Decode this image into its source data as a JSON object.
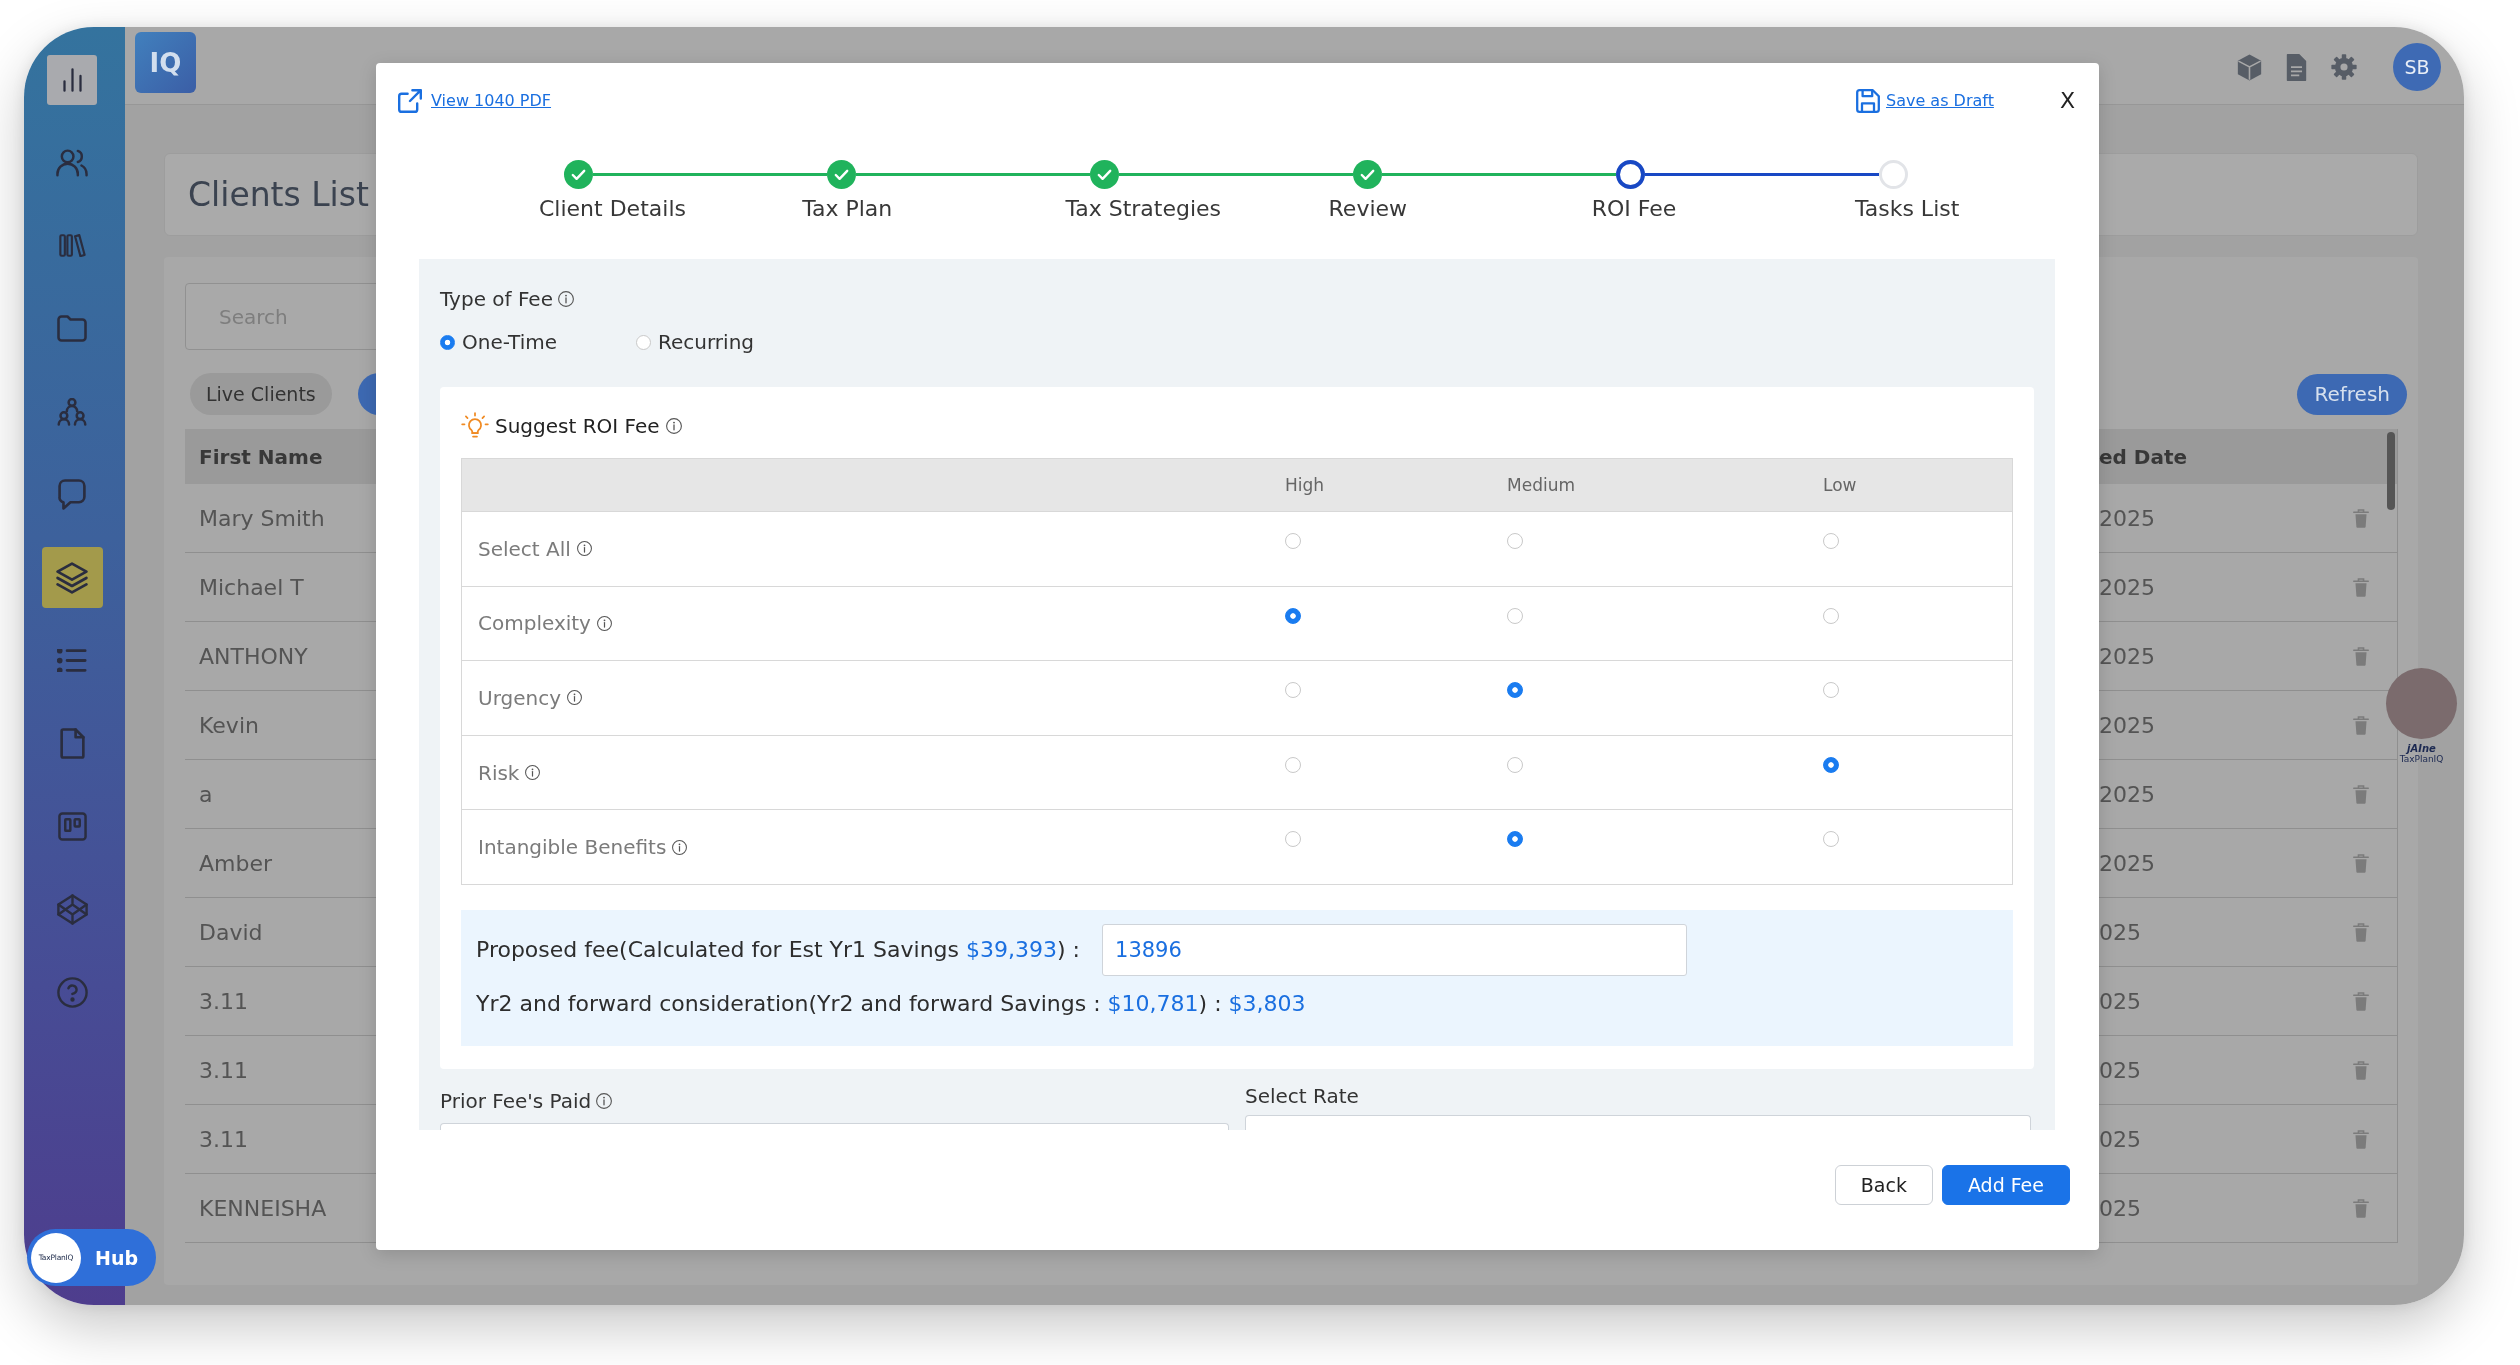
{
  "sidebar": {
    "items": [
      {
        "highlighted": true,
        "selected": false
      },
      {
        "highlighted": false,
        "selected": false
      },
      {
        "highlighted": false,
        "selected": false
      },
      {
        "highlighted": false,
        "selected": false
      },
      {
        "highlighted": false,
        "selected": false
      },
      {
        "highlighted": false,
        "selected": false
      },
      {
        "highlighted": false,
        "selected": true
      },
      {
        "highlighted": false,
        "selected": false
      },
      {
        "highlighted": false,
        "selected": false
      },
      {
        "highlighted": false,
        "selected": false
      },
      {
        "highlighted": false,
        "selected": false
      },
      {
        "highlighted": false,
        "selected": false
      }
    ]
  },
  "header": {
    "logo": "IQ",
    "avatar": "SB"
  },
  "clients_list": {
    "title": "Clients List",
    "search": {
      "placeholder": "Search"
    },
    "filters": [
      {
        "label": "Live Clients",
        "selected": false
      },
      {
        "selected": true
      }
    ],
    "refresh_button": "Refresh",
    "table": {
      "columns": [
        "First Name",
        "ed Date"
      ],
      "rows": [
        {
          "cells": [
            "Mary Smith",
            "2025"
          ]
        },
        {
          "cells": [
            "Michael T",
            "2025"
          ]
        },
        {
          "cells": [
            "ANTHONY",
            "2025"
          ]
        },
        {
          "cells": [
            "Kevin",
            "2025"
          ]
        },
        {
          "cells": [
            "a",
            "2025"
          ]
        },
        {
          "cells": [
            "Amber",
            "2025"
          ]
        },
        {
          "cells": [
            "David",
            "025"
          ]
        },
        {
          "cells": [
            "3.11",
            "025"
          ]
        },
        {
          "cells": [
            "3.11",
            "025"
          ]
        },
        {
          "cells": [
            "3.11",
            "025"
          ]
        },
        {
          "cells": [
            "KENNEISHA",
            "025"
          ]
        }
      ]
    }
  },
  "assistant": {
    "name": "jAIne",
    "brand": "TaxPlanIQ"
  },
  "hub": {
    "logo": "TaxPlanIQ",
    "label": "Hub"
  },
  "modal": {
    "view_pdf_link": "View 1040 PDF",
    "save_draft_link": "Save as Draft",
    "close": "X",
    "steps": [
      {
        "label": "Client Details",
        "completed": true,
        "selected": false
      },
      {
        "label": "Tax Plan",
        "completed": true,
        "selected": false
      },
      {
        "label": "Tax Strategies",
        "completed": true,
        "selected": false
      },
      {
        "label": "Review",
        "completed": true,
        "selected": false
      },
      {
        "label": "ROI Fee",
        "completed": false,
        "selected": true
      },
      {
        "label": "Tasks List",
        "completed": false,
        "selected": false
      }
    ],
    "fee_type": {
      "label": "Type of Fee",
      "info": true,
      "options": [
        {
          "label": "One-Time",
          "selected": true
        },
        {
          "label": "Recurring",
          "selected": false
        }
      ]
    },
    "roi": {
      "title": "Suggest ROI Fee",
      "info": true,
      "columns": [
        "High",
        "Medium",
        "Low"
      ],
      "rows": [
        {
          "label": "Select All",
          "info": true,
          "choices": [
            {
              "selected": false
            },
            {
              "selected": false
            },
            {
              "selected": false
            }
          ]
        },
        {
          "label": "Complexity",
          "info": true,
          "choices": [
            {
              "selected": true
            },
            {
              "selected": false
            },
            {
              "selected": false
            }
          ]
        },
        {
          "label": "Urgency",
          "info": true,
          "choices": [
            {
              "selected": false
            },
            {
              "selected": true
            },
            {
              "selected": false
            }
          ]
        },
        {
          "label": "Risk",
          "info": true,
          "choices": [
            {
              "selected": false
            },
            {
              "selected": false
            },
            {
              "selected": true
            }
          ]
        },
        {
          "label": "Intangible Benefits",
          "info": true,
          "choices": [
            {
              "selected": false
            },
            {
              "selected": true
            },
            {
              "selected": false
            }
          ]
        }
      ]
    },
    "proposed": {
      "line_1": [
        {
          "text": "Proposed fee(Calculated for Est Yr1 Savings ",
          "kind": "text"
        },
        {
          "text": "$39,393",
          "kind": "amount"
        },
        {
          "text": ") :",
          "kind": "text"
        }
      ],
      "value": "13896",
      "line_2": [
        {
          "text": "Yr2 and forward consideration(Yr2 and forward Savings : ",
          "kind": "text"
        },
        {
          "text": "$10,781",
          "kind": "amount"
        },
        {
          "text": ") : ",
          "kind": "text"
        },
        {
          "text": "$3,803",
          "kind": "amount"
        }
      ]
    },
    "prior_fees": {
      "label": "Prior Fee's Paid",
      "info": true
    },
    "select_rate": {
      "label": "Select Rate",
      "info": false
    },
    "buttons": [
      {
        "label": "Back",
        "kind": "secondary"
      },
      {
        "label": "Add Fee",
        "kind": "primary"
      }
    ]
  }
}
